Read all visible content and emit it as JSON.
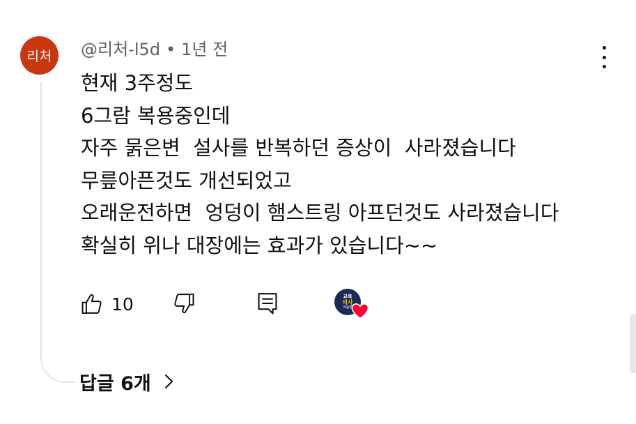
{
  "comment": {
    "avatar_text": "리처",
    "avatar_color": "#c8370f",
    "author": "@리처-l5d",
    "separator": "•",
    "timestamp": "1년 전",
    "lines": [
      "현재 3주정도",
      "6그람 복용중인데",
      "자주 묽은변  설사를 반복하던 증상이  사라졌습니다",
      "무릎아픈것도 개선되었고",
      "오래운전하면  엉덩이 햄스트링 아프던것도 사라졌습니다",
      "확실히 위나 대장에는 효과가 있습니다~~"
    ],
    "like_count": "10",
    "replies_label": "답글 6개",
    "creator_heart": {
      "creator_avatar_lines": [
        "교육",
        "의사",
        "이동환"
      ],
      "heart_color": "#ff0033"
    },
    "more_menu_icon": "vertical-dots-icon",
    "icons": {
      "like": "thumb-up-icon",
      "dislike": "thumb-down-icon",
      "reply": "reply-comment-icon",
      "replies": "chevron-right-icon"
    }
  }
}
